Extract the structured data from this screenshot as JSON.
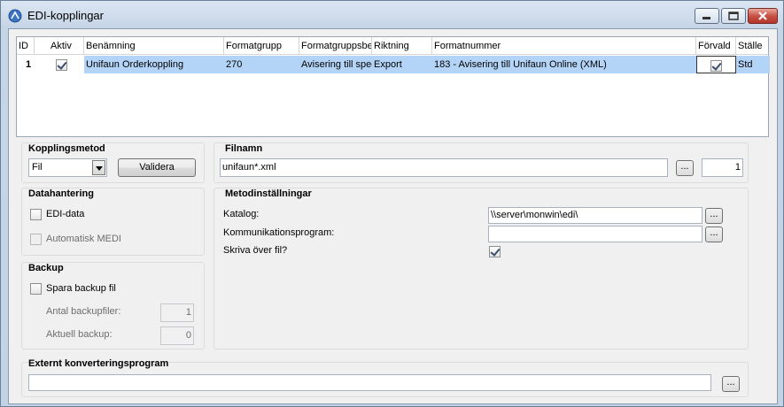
{
  "window": {
    "title": "EDI-kopplingar",
    "icons": {
      "app": "edi-app-icon",
      "minimize": "minimize-icon",
      "maximize": "maximize-icon",
      "close": "close-icon"
    }
  },
  "grid": {
    "columns": [
      "ID",
      "Aktiv",
      "Benämning",
      "Formatgrupp",
      "Formatgruppsben",
      "Riktning",
      "Formatnummer",
      "Förvald",
      "Ställe"
    ],
    "rows": [
      {
        "id": "1",
        "aktiv": true,
        "benamning": "Unifaun Orderkoppling",
        "formatgrupp": "270",
        "formatgruppsben": "Avisering till spec",
        "riktning": "Export",
        "formatnummer": "183 - Avisering till Unifaun Online (XML)",
        "forvald": true,
        "stalle": "Std"
      }
    ]
  },
  "kopplingsmetod": {
    "title": "Kopplingsmetod",
    "value": "Fil",
    "validate_label": "Validera"
  },
  "filnamn": {
    "title": "Filnamn",
    "value": "unifaun*.xml",
    "browse_label": "...",
    "number": "1"
  },
  "datahantering": {
    "title": "Datahantering",
    "edi_data": {
      "label": "EDI-data",
      "checked": false
    },
    "medi": {
      "label": "Automatisk MEDI",
      "checked": false
    }
  },
  "metod": {
    "title": "Metodinställningar",
    "katalog_label": "Katalog:",
    "katalog_value": "\\\\server\\monwin\\edi\\",
    "komm_label": "Kommunikationsprogram:",
    "komm_value": "",
    "skriva_label": "Skriva över fil?",
    "skriva_checked": true,
    "browse_label": "..."
  },
  "backup": {
    "title": "Backup",
    "spara_label": "Spara backup fil",
    "spara_checked": false,
    "antal_label": "Antal backupfiler:",
    "antal_value": "1",
    "aktuell_label": "Aktuell backup:",
    "aktuell_value": "0"
  },
  "externt": {
    "title": "Externt konverteringsprogram",
    "value": "",
    "browse_label": "..."
  },
  "colors": {
    "selection": "#b4d4f7",
    "frame": "#c3d3e5",
    "client": "#f0f0f0"
  }
}
